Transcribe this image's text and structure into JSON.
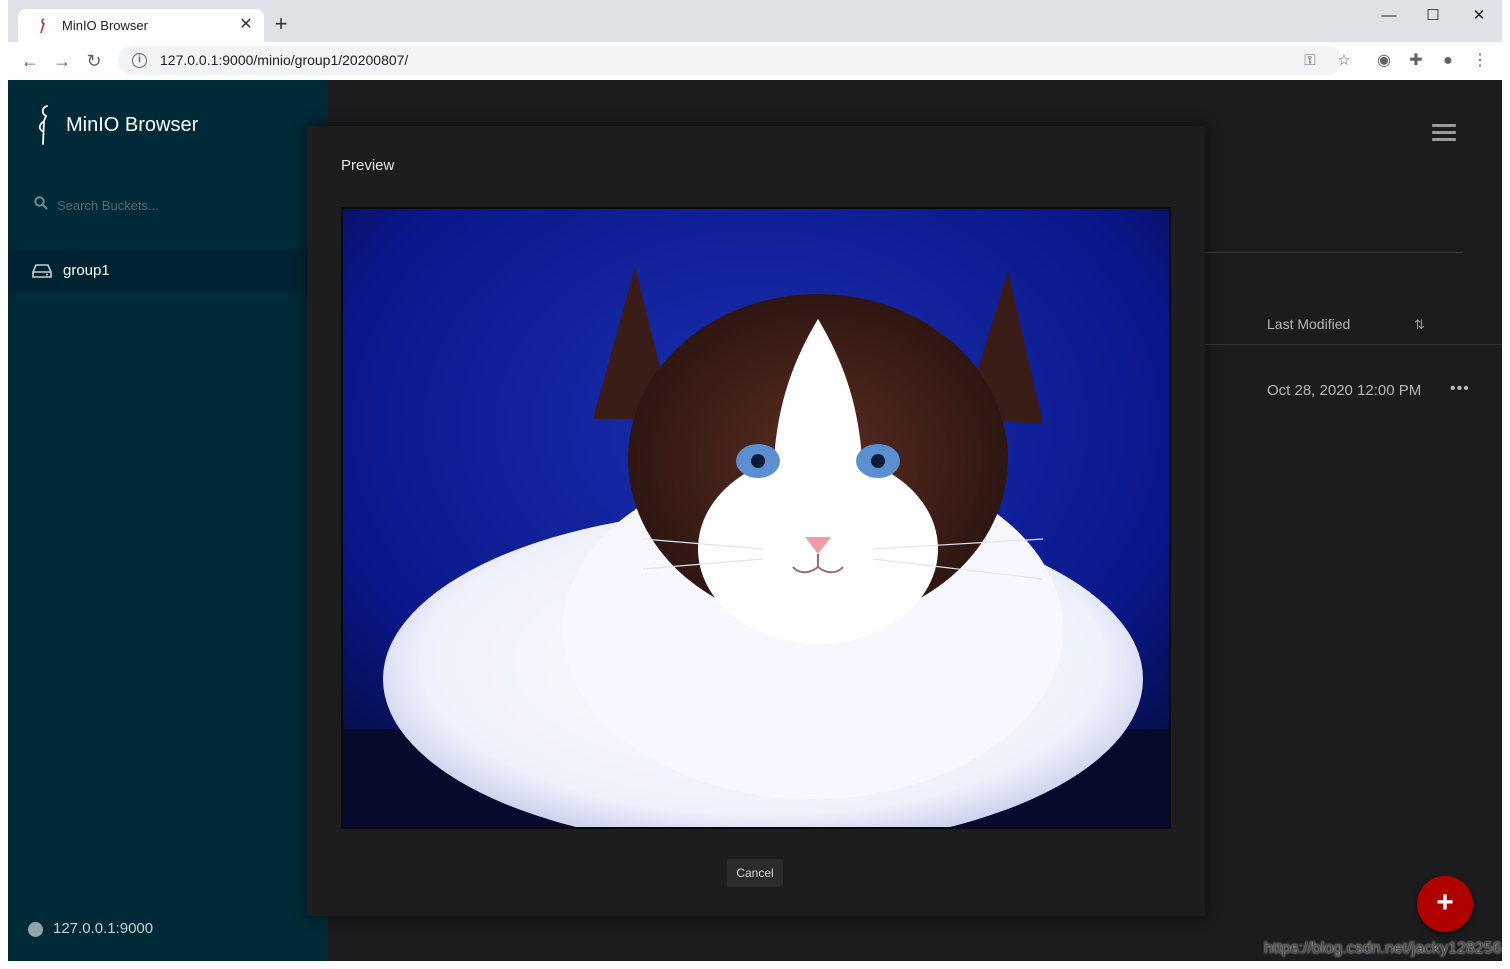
{
  "browser": {
    "tab_title": "MinIO Browser",
    "tab_close": "✕",
    "new_tab": "+",
    "window_controls": {
      "minimize": "—",
      "maximize": "☐",
      "close": "✕"
    },
    "url": "127.0.0.1:9000/minio/group1/20200807/",
    "nav": {
      "back": "←",
      "forward": "→",
      "reload": "↻"
    },
    "icons": [
      "key-icon",
      "star-icon",
      "extension-avatar-icon",
      "puzzle-icon",
      "profile-icon",
      "kebab-menu-icon"
    ]
  },
  "sidebar": {
    "brand": "MinIO Browser",
    "search_placeholder": "Search Buckets...",
    "buckets": [
      {
        "label": "group1"
      }
    ],
    "host": "127.0.0.1:9000"
  },
  "main": {
    "columns": {
      "last_modified": "Last Modified",
      "sort_icon": "⇅"
    },
    "rows": [
      {
        "last_modified": "Oct 28, 2020 12:00 PM",
        "actions": "•••"
      }
    ],
    "fab_label": "+"
  },
  "modal": {
    "title": "Preview",
    "cancel_label": "Cancel"
  },
  "watermark": "https://blog.csdn.net/jacky128256",
  "colors": {
    "sidebar": "#002a37",
    "main_bg": "#1c1c1e",
    "fab": "#b00000",
    "preview_bg": "#0b1980"
  }
}
